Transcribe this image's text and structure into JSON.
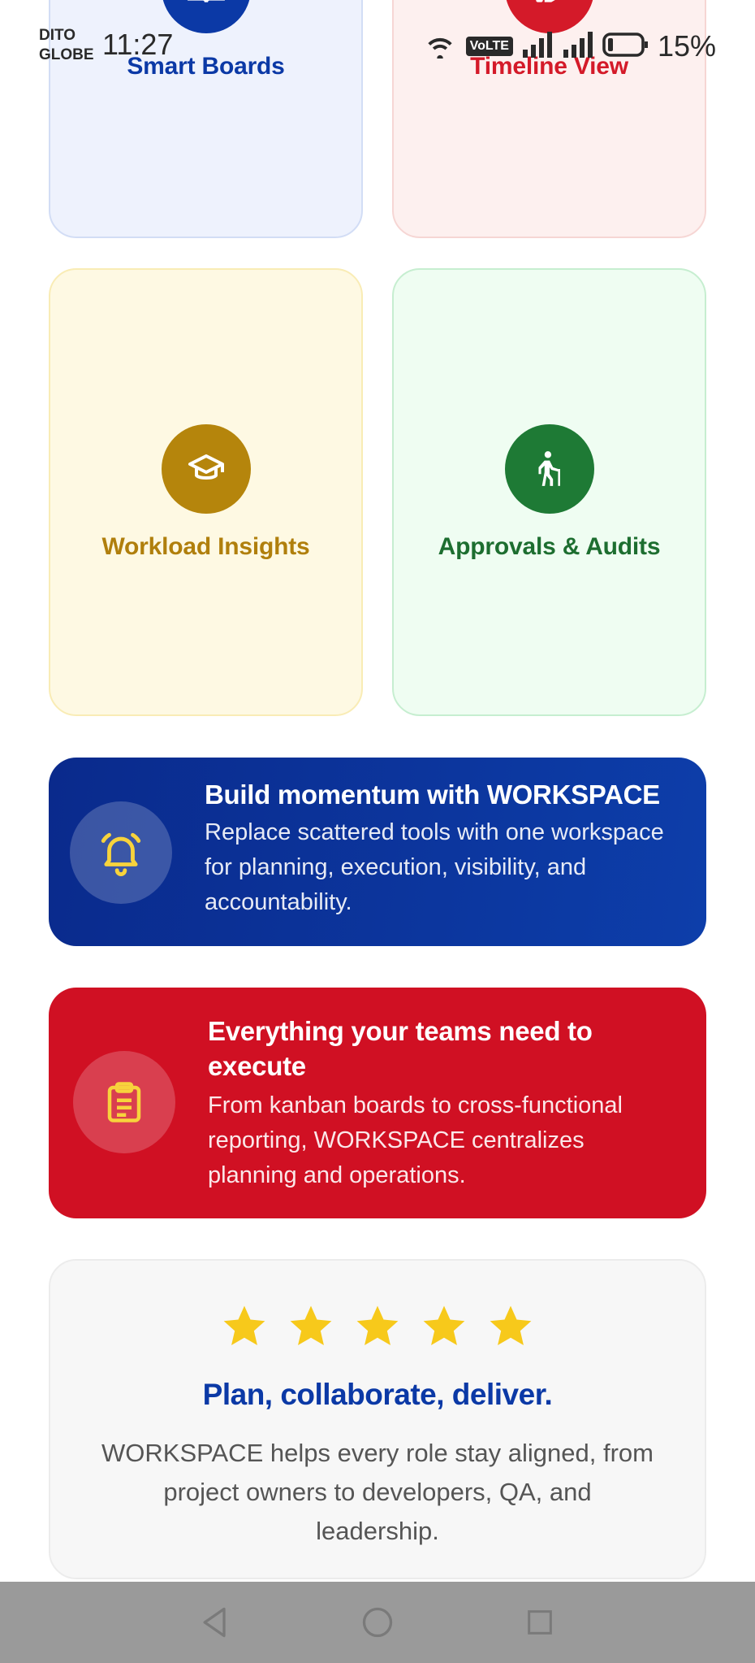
{
  "status_bar": {
    "carrier_1": "DITO",
    "carrier_2": "GLOBE",
    "time": "11:27",
    "network_badge": "VoLTE",
    "battery": "15%"
  },
  "feature_cards": [
    {
      "label": "Smart Boards",
      "icon": "book-icon",
      "color": "#0b39a6"
    },
    {
      "label": "Timeline View",
      "icon": "hand-icon",
      "color": "#d41a29"
    },
    {
      "label": "Workload Insights",
      "icon": "graduation-cap-icon",
      "color": "#b5850c"
    },
    {
      "label": "Approvals & Audits",
      "icon": "person-cane-icon",
      "color": "#1e7a35"
    }
  ],
  "banners": [
    {
      "title": "Build momentum with WORKSPACE",
      "body": "Replace scattered tools with one workspace for planning, execution, visibility, and accountability.",
      "icon": "bell-icon",
      "color": "#0b39a6"
    },
    {
      "title": "Everything your teams need to execute",
      "body": "From kanban boards to cross-functional reporting, WORKSPACE centralizes planning and operations.",
      "icon": "clipboard-icon",
      "color": "#d01023"
    }
  ],
  "review": {
    "rating": 5,
    "max_rating": 5,
    "title": "Plan, collaborate, deliver.",
    "body": "WORKSPACE helps every role stay aligned, from project owners to developers, QA, and leadership."
  },
  "nav": {
    "buttons": [
      "back-icon",
      "home-icon",
      "recents-icon"
    ]
  }
}
